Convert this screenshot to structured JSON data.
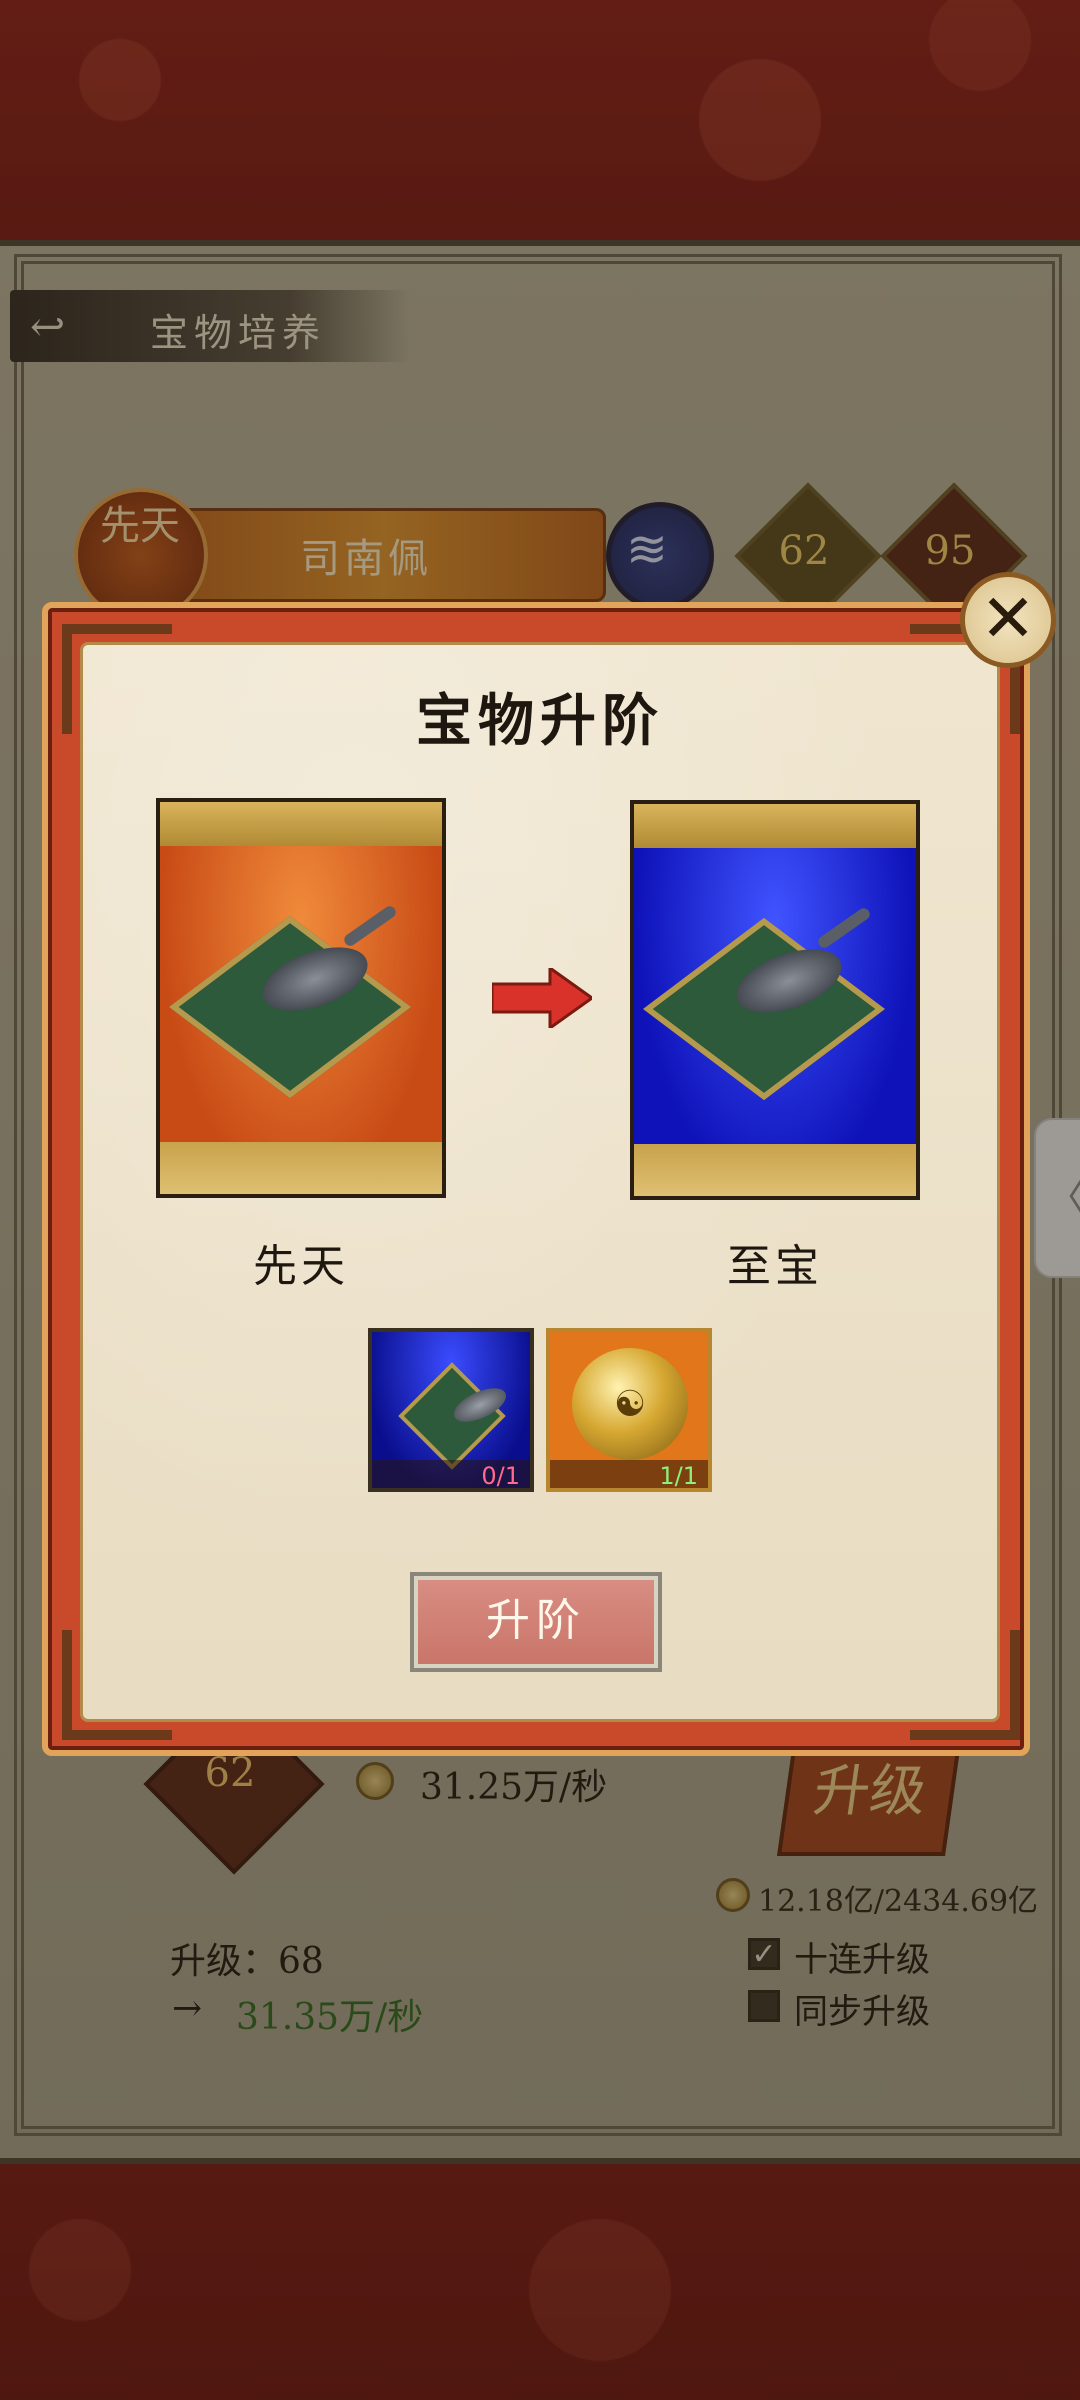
{
  "header": {
    "title": "宝物培养"
  },
  "hero": {
    "grade": "先天",
    "name": "司南佩",
    "stat_a": "62",
    "stat_b": "95"
  },
  "under_panel": {
    "level_badge": "62",
    "rate": "31.25万/秒",
    "upgrade_label": "升级",
    "cost": "12.18亿/2434.69亿",
    "level_line": "升级：68",
    "arrow": "→",
    "next_rate": "31.35万/秒",
    "options": [
      {
        "label": "十连升级",
        "checked": true
      },
      {
        "label": "同步升级",
        "checked": false
      }
    ]
  },
  "modal": {
    "title": "宝物升阶",
    "from_label": "先天",
    "to_label": "至宝",
    "materials": [
      {
        "count": "0/1",
        "count_color": "#ff6a8a"
      },
      {
        "count": "1/1",
        "count_color": "#8ef07a"
      }
    ],
    "action_label": "升阶",
    "close_symbol": "✕"
  },
  "side_tab": {
    "symbol": "〈"
  }
}
